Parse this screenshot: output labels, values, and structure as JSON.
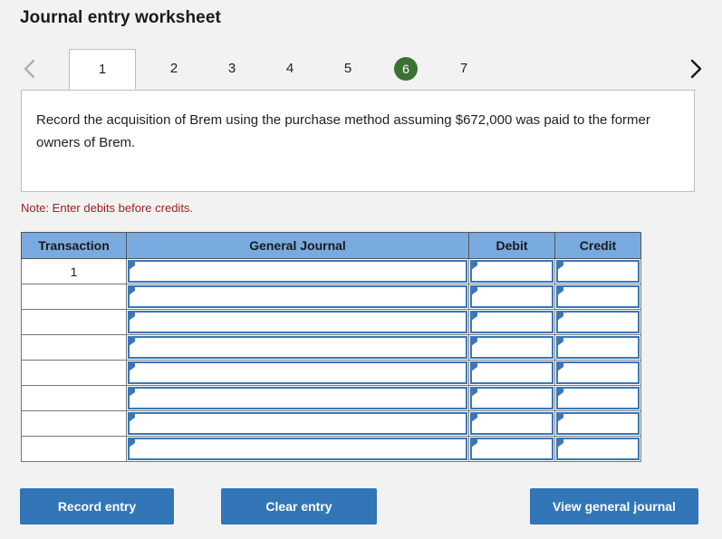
{
  "page": {
    "title": "Journal entry worksheet"
  },
  "tabs": {
    "prev_label": "chevron-left",
    "next_label": "chevron-right",
    "items": [
      {
        "label": "1",
        "active": true,
        "badge": false
      },
      {
        "label": "2",
        "active": false,
        "badge": false
      },
      {
        "label": "3",
        "active": false,
        "badge": false
      },
      {
        "label": "4",
        "active": false,
        "badge": false
      },
      {
        "label": "5",
        "active": false,
        "badge": false
      },
      {
        "label": "6",
        "active": false,
        "badge": true
      },
      {
        "label": "7",
        "active": false,
        "badge": false
      }
    ],
    "badge_color": "#3c7134"
  },
  "instruction": {
    "text": "Record the acquisition of Brem using the purchase method assuming $672,000 was paid to the former owners of Brem."
  },
  "note": {
    "text": "Note: Enter debits before credits.",
    "color": "#a02020"
  },
  "table": {
    "headers": [
      "Transaction",
      "General Journal",
      "Debit",
      "Credit"
    ],
    "header_color": "#78aae0",
    "rows": [
      {
        "transaction": "1",
        "general_journal": "",
        "debit": "",
        "credit": ""
      },
      {
        "transaction": "",
        "general_journal": "",
        "debit": "",
        "credit": ""
      },
      {
        "transaction": "",
        "general_journal": "",
        "debit": "",
        "credit": ""
      },
      {
        "transaction": "",
        "general_journal": "",
        "debit": "",
        "credit": ""
      },
      {
        "transaction": "",
        "general_journal": "",
        "debit": "",
        "credit": ""
      },
      {
        "transaction": "",
        "general_journal": "",
        "debit": "",
        "credit": ""
      },
      {
        "transaction": "",
        "general_journal": "",
        "debit": "",
        "credit": ""
      },
      {
        "transaction": "",
        "general_journal": "",
        "debit": "",
        "credit": ""
      }
    ]
  },
  "buttons": {
    "record_entry": "Record entry",
    "clear_entry": "Clear entry",
    "view_general_journal": "View general journal",
    "color": "#3276b8"
  }
}
